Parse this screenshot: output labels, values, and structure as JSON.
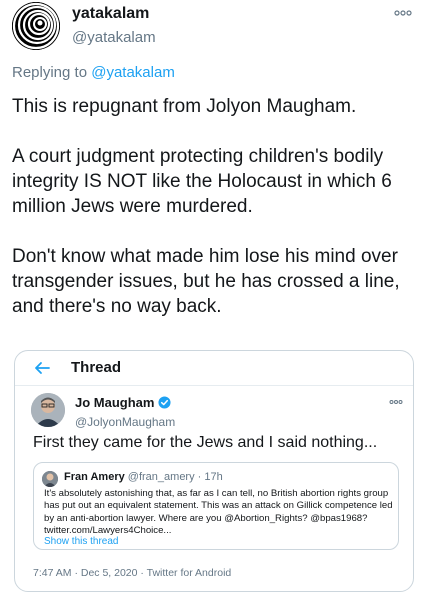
{
  "tweet": {
    "author_name": "yatakalam",
    "author_handle": "@yatakalam",
    "replying_prefix": "Replying to",
    "replying_to": "@yatakalam",
    "paragraphs": [
      "This is repugnant from Jolyon Maugham.",
      "A court judgment protecting children's bodily integrity IS NOT like the Holocaust in which 6 million Jews were murdered.",
      "Don't know what made him lose his mind over transgender issues, but he has crossed a line, and there's no way back."
    ]
  },
  "quote": {
    "header_title": "Thread",
    "author_name": "Jo Maugham",
    "author_handle": "@JolyonMaugham",
    "text": "First they came for the Jews and I said nothing...",
    "footer": "7:47 AM · Dec 5, 2020 · Twitter for Android",
    "inner": {
      "author_name": "Fran Amery",
      "meta": "@fran_amery · 17h",
      "lines": [
        "It's absolutely astonishing that, as far as I can tell, no British abortion rights group",
        "has put out an equivalent statement. This was an attack on Gillick competence led",
        "by an anti-abortion lawyer. Where are you @Abortion_Rights? @bpas1968?",
        "twitter.com/Lawyers4Choice..."
      ],
      "show_thread": "Show this thread"
    }
  },
  "colors": {
    "link": "#1da1f2",
    "secondary": "#657786",
    "border": "#ccd6dd"
  },
  "icons": [
    "spiral-avatar",
    "more-icon",
    "back-arrow-icon",
    "verified-badge-icon"
  ]
}
